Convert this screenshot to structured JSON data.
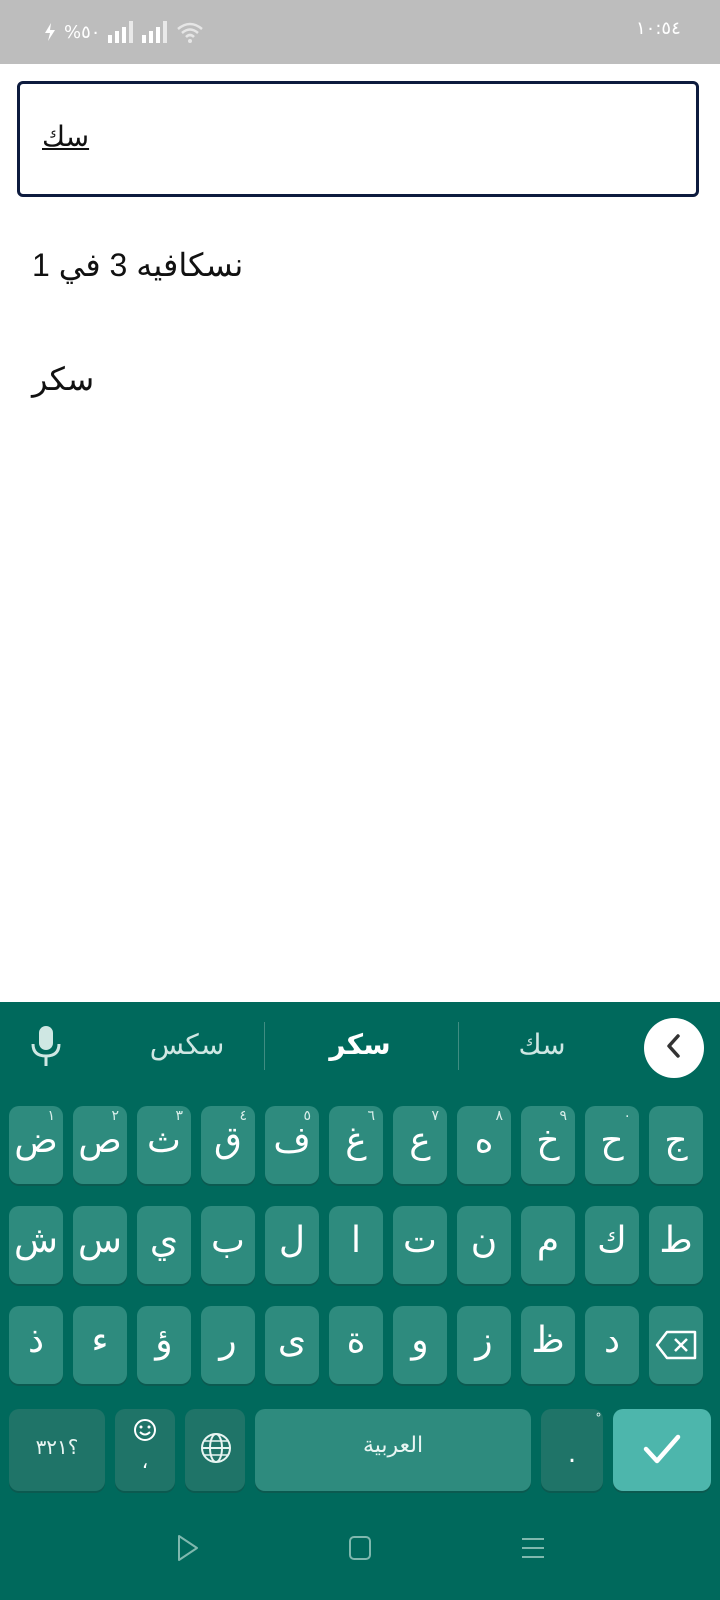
{
  "status_bar": {
    "time": "١٠:٥٤",
    "battery": "%٥٠"
  },
  "search": {
    "value": "سك"
  },
  "results": [
    "نسكافيه 3 في 1",
    "سكر"
  ],
  "keyboard": {
    "suggestions": {
      "left": "سكس",
      "center": "سكر",
      "right": "سك"
    },
    "rows": [
      [
        {
          "char": "ض",
          "hint": "١"
        },
        {
          "char": "ص",
          "hint": "٢"
        },
        {
          "char": "ث",
          "hint": "٣"
        },
        {
          "char": "ق",
          "hint": "٤"
        },
        {
          "char": "ف",
          "hint": "٥"
        },
        {
          "char": "غ",
          "hint": "٦"
        },
        {
          "char": "ع",
          "hint": "٧"
        },
        {
          "char": "ه",
          "hint": "٨"
        },
        {
          "char": "خ",
          "hint": "٩"
        },
        {
          "char": "ح",
          "hint": "٠"
        },
        {
          "char": "ج",
          "hint": ""
        }
      ],
      [
        {
          "char": "ش",
          "hint": ""
        },
        {
          "char": "س",
          "hint": ""
        },
        {
          "char": "ي",
          "hint": ""
        },
        {
          "char": "ب",
          "hint": ""
        },
        {
          "char": "ل",
          "hint": ""
        },
        {
          "char": "ا",
          "hint": ""
        },
        {
          "char": "ت",
          "hint": ""
        },
        {
          "char": "ن",
          "hint": ""
        },
        {
          "char": "م",
          "hint": ""
        },
        {
          "char": "ك",
          "hint": ""
        },
        {
          "char": "ط",
          "hint": ""
        }
      ],
      [
        {
          "char": "ذ",
          "hint": ""
        },
        {
          "char": "ء",
          "hint": ""
        },
        {
          "char": "ؤ",
          "hint": ""
        },
        {
          "char": "ر",
          "hint": ""
        },
        {
          "char": "ى",
          "hint": ""
        },
        {
          "char": "ة",
          "hint": ""
        },
        {
          "char": "و",
          "hint": ""
        },
        {
          "char": "ز",
          "hint": ""
        },
        {
          "char": "ظ",
          "hint": ""
        },
        {
          "char": "د",
          "hint": ""
        }
      ]
    ],
    "symbols_label": "؟٣٢١",
    "emoji_comma": "،",
    "space_label": "العربية",
    "dot_label": ".",
    "dot_hint": "ْ",
    "colors": {
      "background": "#00695c",
      "key": "#2e8b7e",
      "enter": "#4db6ac"
    }
  }
}
